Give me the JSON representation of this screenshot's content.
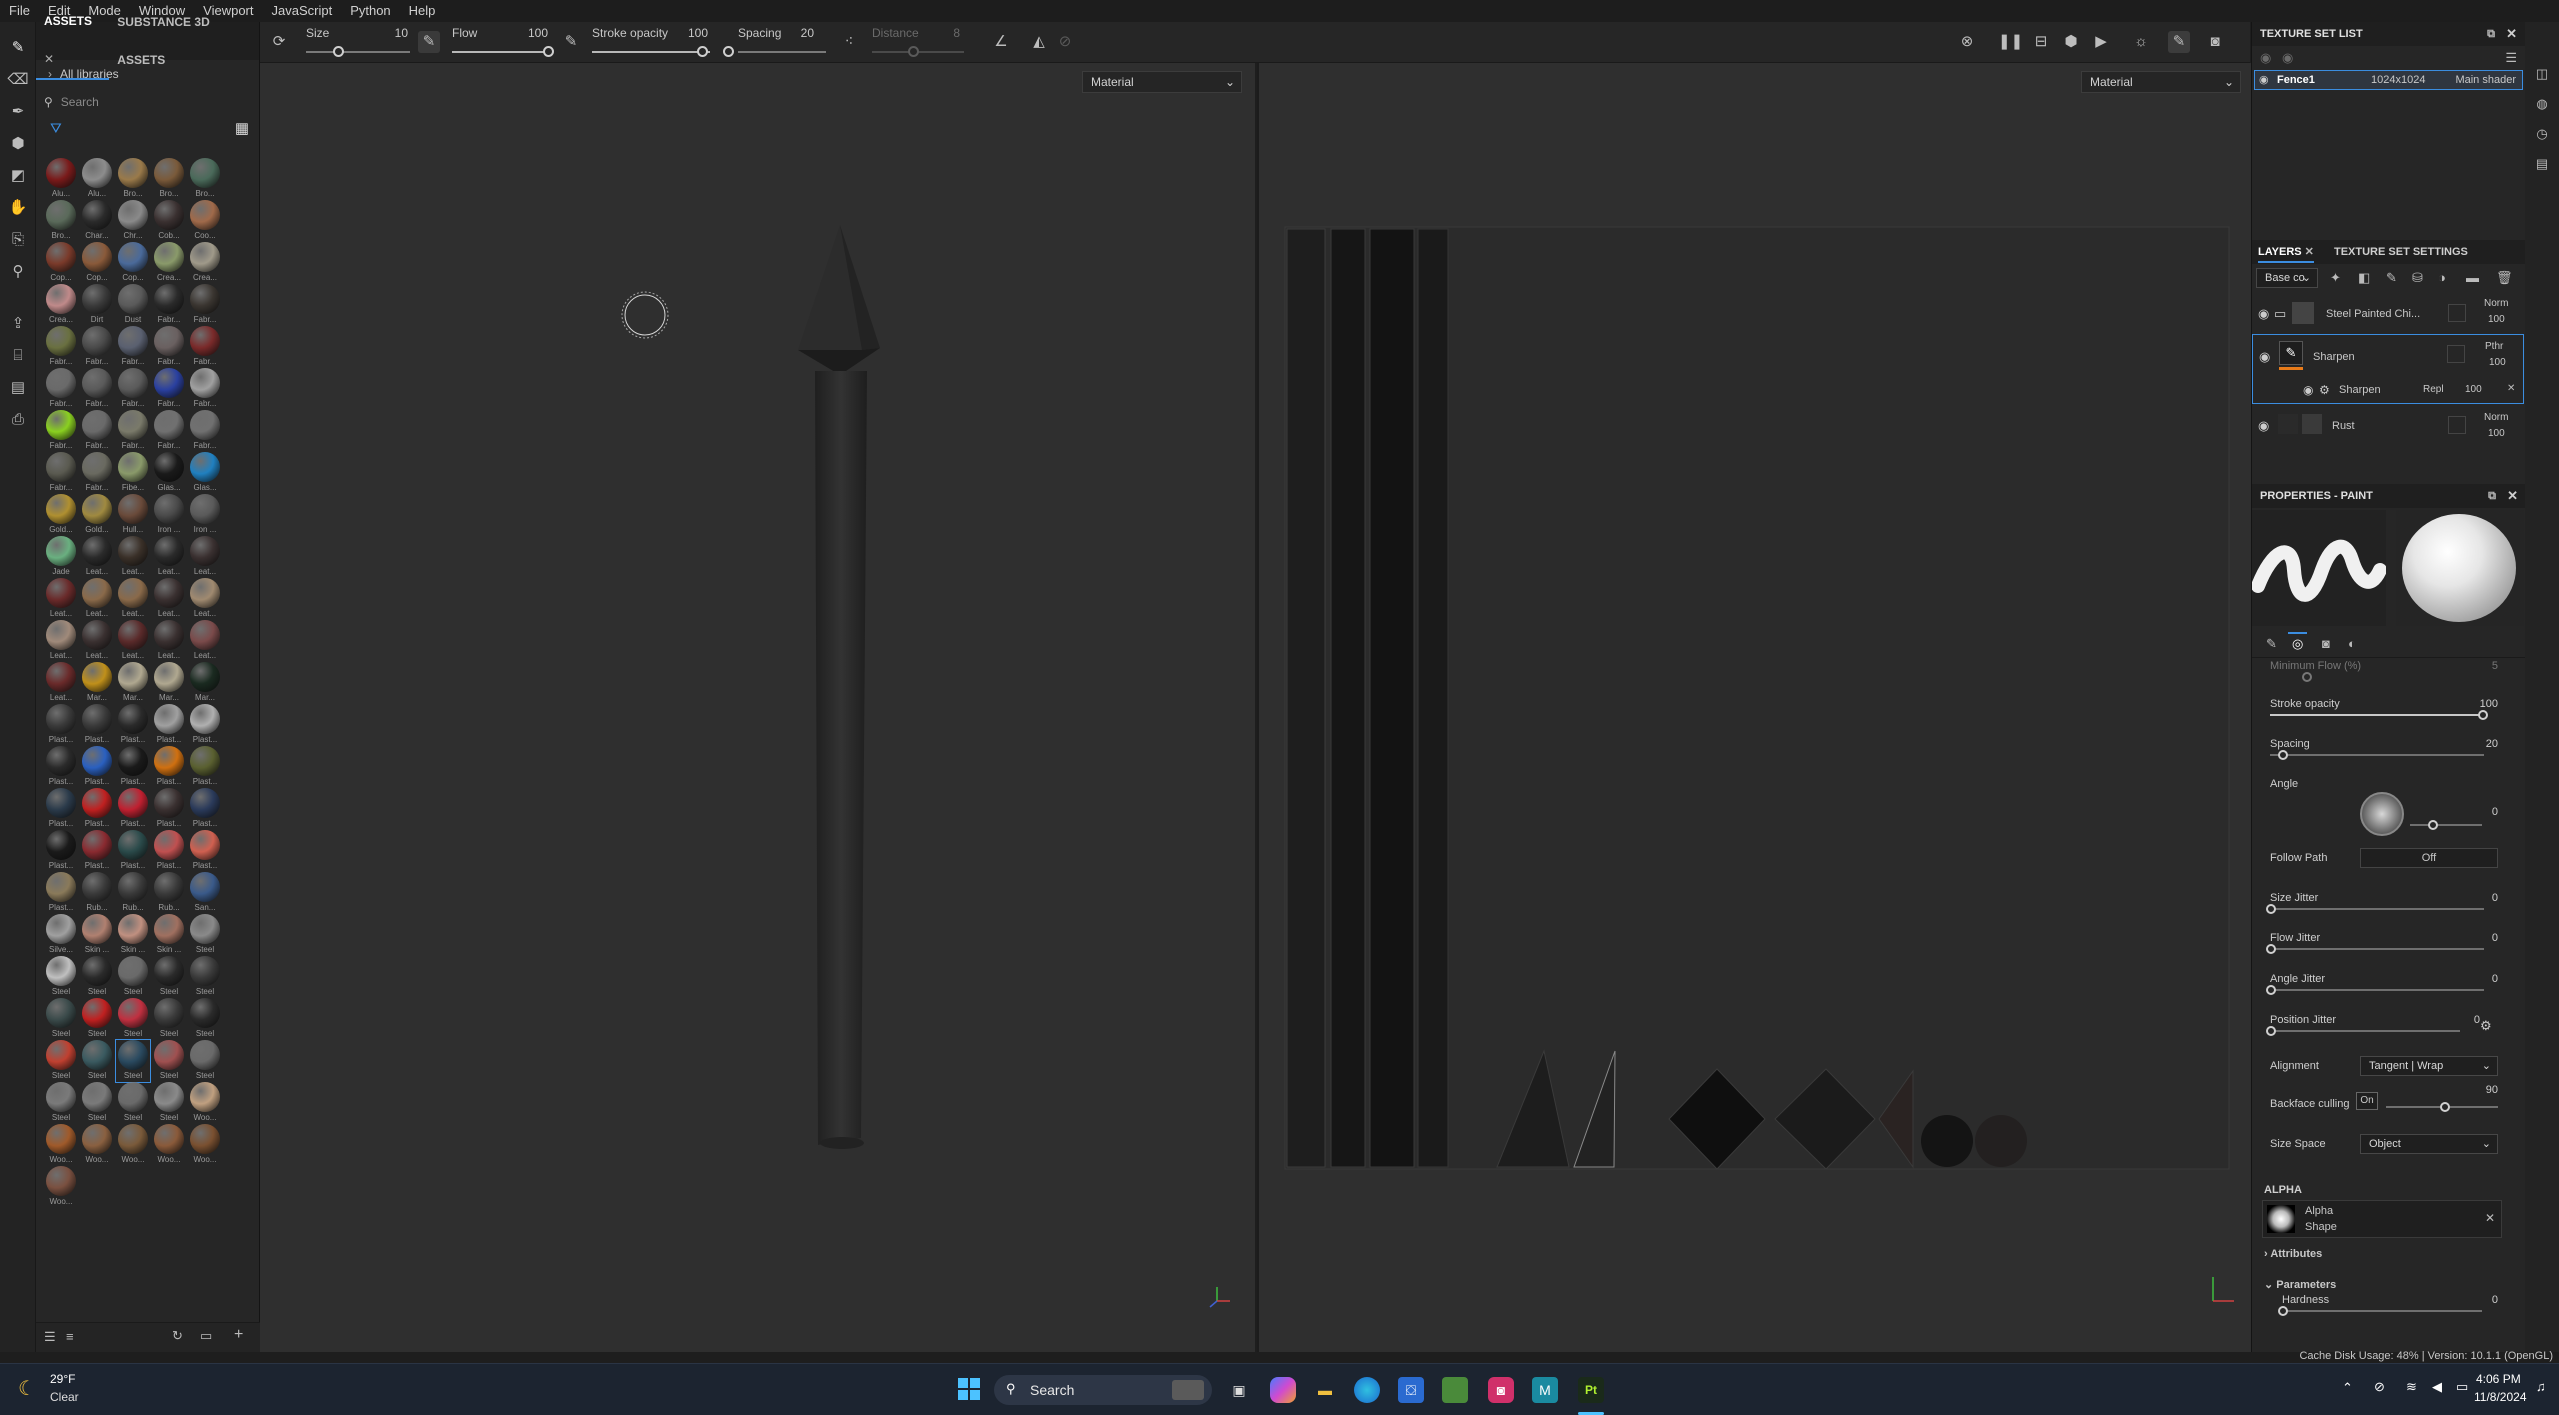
{
  "menu": [
    "File",
    "Edit",
    "Mode",
    "Window",
    "Viewport",
    "JavaScript",
    "Python",
    "Help"
  ],
  "toolbar": {
    "size_label": "Size",
    "size_value": "10",
    "flow_label": "Flow",
    "flow_value": "100",
    "stroke_opacity_label": "Stroke opacity",
    "stroke_opacity_value": "100",
    "spacing_label": "Spacing",
    "spacing_value": "20",
    "distance_label": "Distance",
    "distance_value": "8"
  },
  "assets": {
    "tab_assets": "ASSETS",
    "tab_substance": "SUBSTANCE 3D ASSETS",
    "all_libraries": "All libraries",
    "search_placeholder": "Search",
    "materials": [
      {
        "name": "Alu...",
        "color": "#7a1a1a"
      },
      {
        "name": "Alu...",
        "color": "#8d8d8d"
      },
      {
        "name": "Bro...",
        "color": "#9a7a4a"
      },
      {
        "name": "Bro...",
        "color": "#7a5a3a"
      },
      {
        "name": "Bro...",
        "color": "#4a6a5a"
      },
      {
        "name": "Bro...",
        "color": "#5a6a5a"
      },
      {
        "name": "Char...",
        "color": "#2a2a2a"
      },
      {
        "name": "Chr...",
        "color": "#8a8a8a"
      },
      {
        "name": "Cob...",
        "color": "#3a3030"
      },
      {
        "name": "Coo...",
        "color": "#a06a4a"
      },
      {
        "name": "Cop...",
        "color": "#7a3a2a"
      },
      {
        "name": "Cop...",
        "color": "#8a5a3a"
      },
      {
        "name": "Cop...",
        "color": "#4a6a9a"
      },
      {
        "name": "Crea...",
        "color": "#8a9a6a"
      },
      {
        "name": "Crea...",
        "color": "#a09a8a"
      },
      {
        "name": "Crea...",
        "color": "#c08a8a"
      },
      {
        "name": "Dirt",
        "color": "#3a3a3a"
      },
      {
        "name": "Dust",
        "color": "#5a5a5a"
      },
      {
        "name": "Fabr...",
        "color": "#2a2a2a"
      },
      {
        "name": "Fabr...",
        "color": "#3a3530"
      },
      {
        "name": "Fabr...",
        "color": "#6a7040"
      },
      {
        "name": "Fabr...",
        "color": "#4a4a4a"
      },
      {
        "name": "Fabr...",
        "color": "#5a6070"
      },
      {
        "name": "Fabr...",
        "color": "#6a6060"
      },
      {
        "name": "Fabr...",
        "color": "#7a2a2a"
      },
      {
        "name": "Fabr...",
        "color": "#6a6a6a"
      },
      {
        "name": "Fabr...",
        "color": "#5a5a5a"
      },
      {
        "name": "Fabr...",
        "color": "#5a5a5a"
      },
      {
        "name": "Fabr...",
        "color": "#2a40a0"
      },
      {
        "name": "Fabr...",
        "color": "#a0a0a0"
      },
      {
        "name": "Fabr...",
        "color": "#8ad020"
      },
      {
        "name": "Fabr...",
        "color": "#6a6a6a"
      },
      {
        "name": "Fabr...",
        "color": "#7a7a6a"
      },
      {
        "name": "Fabr...",
        "color": "#707070"
      },
      {
        "name": "Fabr...",
        "color": "#707070"
      },
      {
        "name": "Fabr...",
        "color": "#5a5a50"
      },
      {
        "name": "Fabr...",
        "color": "#6a6a60"
      },
      {
        "name": "Fibe...",
        "color": "#8a9a6a"
      },
      {
        "name": "Glas...",
        "color": "#1a1a1a"
      },
      {
        "name": "Glas...",
        "color": "#2080c0"
      },
      {
        "name": "Gold...",
        "color": "#b09030"
      },
      {
        "name": "Gold...",
        "color": "#a08a40"
      },
      {
        "name": "Hull...",
        "color": "#6a4a3a"
      },
      {
        "name": "Iron ...",
        "color": "#4a4a4a"
      },
      {
        "name": "Iron ...",
        "color": "#5a5a5a"
      },
      {
        "name": "Jade",
        "color": "#6ab080"
      },
      {
        "name": "Leat...",
        "color": "#2a2a2a"
      },
      {
        "name": "Leat...",
        "color": "#3a3028"
      },
      {
        "name": "Leat...",
        "color": "#2a2a2a"
      },
      {
        "name": "Leat...",
        "color": "#3a3030"
      },
      {
        "name": "Leat...",
        "color": "#6a2a2a"
      },
      {
        "name": "Leat...",
        "color": "#8a6a4a"
      },
      {
        "name": "Leat...",
        "color": "#8a6a4a"
      },
      {
        "name": "Leat...",
        "color": "#3a3030"
      },
      {
        "name": "Leat...",
        "color": "#a08a70"
      },
      {
        "name": "Leat...",
        "color": "#a08a7a"
      },
      {
        "name": "Leat...",
        "color": "#3a3030"
      },
      {
        "name": "Leat...",
        "color": "#5a2a2a"
      },
      {
        "name": "Leat...",
        "color": "#3a3030"
      },
      {
        "name": "Leat...",
        "color": "#7a4a4a"
      },
      {
        "name": "Leat...",
        "color": "#6a2a2a"
      },
      {
        "name": "Mar...",
        "color": "#c0901a"
      },
      {
        "name": "Mar...",
        "color": "#b0a890"
      },
      {
        "name": "Mar...",
        "color": "#b0a890"
      },
      {
        "name": "Mar...",
        "color": "#1a2a20"
      },
      {
        "name": "Plast...",
        "color": "#3a3a3a"
      },
      {
        "name": "Plast...",
        "color": "#3a3a3a"
      },
      {
        "name": "Plast...",
        "color": "#2a2a2a"
      },
      {
        "name": "Plast...",
        "color": "#a0a0a0"
      },
      {
        "name": "Plast...",
        "color": "#b0b0b0"
      },
      {
        "name": "Plast...",
        "color": "#2a2a2a"
      },
      {
        "name": "Plast...",
        "color": "#2a60c0"
      },
      {
        "name": "Plast...",
        "color": "#1a1a1a"
      },
      {
        "name": "Plast...",
        "color": "#d07010"
      },
      {
        "name": "Plast...",
        "color": "#5a6030"
      },
      {
        "name": "Plast...",
        "color": "#2a3a4a"
      },
      {
        "name": "Plast...",
        "color": "#c02020"
      },
      {
        "name": "Plast...",
        "color": "#c02030"
      },
      {
        "name": "Plast...",
        "color": "#3a3030"
      },
      {
        "name": "Plast...",
        "color": "#2a3a5a"
      },
      {
        "name": "Plast...",
        "color": "#1a1a1a"
      },
      {
        "name": "Plast...",
        "color": "#8a2a30"
      },
      {
        "name": "Plast...",
        "color": "#2a4a4a"
      },
      {
        "name": "Plast...",
        "color": "#c05050"
      },
      {
        "name": "Plast...",
        "color": "#d06050"
      },
      {
        "name": "Plast...",
        "color": "#8a7a5a"
      },
      {
        "name": "Rub...",
        "color": "#3a3a3a"
      },
      {
        "name": "Rub...",
        "color": "#3a3a3a"
      },
      {
        "name": "Rub...",
        "color": "#3a3a3a"
      },
      {
        "name": "San...",
        "color": "#3a5a8a"
      },
      {
        "name": "Silve...",
        "color": "#a0a0a0"
      },
      {
        "name": "Skin ...",
        "color": "#b08070"
      },
      {
        "name": "Skin ...",
        "color": "#c09080"
      },
      {
        "name": "Skin ...",
        "color": "#a07060"
      },
      {
        "name": "Steel",
        "color": "#8a8a8a"
      },
      {
        "name": "Steel",
        "color": "#c0c0c0"
      },
      {
        "name": "Steel",
        "color": "#2a2a2a"
      },
      {
        "name": "Steel",
        "color": "#6a6a6a"
      },
      {
        "name": "Steel",
        "color": "#2a2a2a"
      },
      {
        "name": "Steel",
        "color": "#3a3a3a"
      },
      {
        "name": "Steel",
        "color": "#3a4a4a"
      },
      {
        "name": "Steel",
        "color": "#c02020"
      },
      {
        "name": "Steel",
        "color": "#c03040"
      },
      {
        "name": "Steel",
        "color": "#3a3a3a"
      },
      {
        "name": "Steel",
        "color": "#2a2a2a"
      },
      {
        "name": "Steel",
        "color": "#c04030"
      },
      {
        "name": "Steel",
        "color": "#3a5a60"
      },
      {
        "name": "Steel",
        "color": "#2a4a60"
      },
      {
        "name": "Steel",
        "color": "#a05050"
      },
      {
        "name": "Steel",
        "color": "#6a6a6a"
      },
      {
        "name": "Steel",
        "color": "#7a7a7a"
      },
      {
        "name": "Steel",
        "color": "#7a7a7a"
      },
      {
        "name": "Steel",
        "color": "#6a6a6a"
      },
      {
        "name": "Steel",
        "color": "#8a8a8a"
      },
      {
        "name": "Woo...",
        "color": "#c0a080"
      },
      {
        "name": "Woo...",
        "color": "#a05a2a"
      },
      {
        "name": "Woo...",
        "color": "#8a6040"
      },
      {
        "name": "Woo...",
        "color": "#7a5a3a"
      },
      {
        "name": "Woo...",
        "color": "#8a5a3a"
      },
      {
        "name": "Woo...",
        "color": "#7a5030"
      },
      {
        "name": "Woo...",
        "color": "#7a5040"
      }
    ]
  },
  "viewport3d": {
    "material_select": "Material"
  },
  "viewport2d": {
    "material_select": "Material"
  },
  "texture_set_list": {
    "title": "TEXTURE SET LIST",
    "name": "Fence1",
    "resolution": "1024x1024",
    "shader": "Main shader"
  },
  "layers": {
    "tab_layers": "LAYERS",
    "tab_settings": "TEXTURE SET SETTINGS",
    "channel_select": "Base co",
    "items": [
      {
        "name": "Steel Painted Chi...",
        "blend": "Norm",
        "opacity": "100"
      },
      {
        "name": "Sharpen",
        "blend": "Pthr",
        "opacity": "100"
      },
      {
        "name": "Sharpen",
        "blend": "Repl",
        "opacity": "100"
      },
      {
        "name": "Rust",
        "blend": "Norm",
        "opacity": "100"
      }
    ]
  },
  "properties": {
    "title": "PROPERTIES - PAINT",
    "min_flow_label": "Minimum Flow (%)",
    "min_flow_value": "5",
    "stroke_opacity_label": "Stroke opacity",
    "stroke_opacity_value": "100",
    "spacing_label": "Spacing",
    "spacing_value": "20",
    "angle_label": "Angle",
    "angle_value": "0",
    "follow_path_label": "Follow Path",
    "follow_path_value": "Off",
    "size_jitter_label": "Size Jitter",
    "size_jitter_value": "0",
    "flow_jitter_label": "Flow Jitter",
    "flow_jitter_value": "0",
    "angle_jitter_label": "Angle Jitter",
    "angle_jitter_value": "0",
    "position_jitter_label": "Position Jitter",
    "position_jitter_value": "0",
    "alignment_label": "Alignment",
    "alignment_value": "Tangent | Wrap",
    "backface_label": "Backface culling",
    "backface_value": "On",
    "backface_angle": "90",
    "size_space_label": "Size Space",
    "size_space_value": "Object",
    "alpha_section": "ALPHA",
    "alpha_name": "Alpha",
    "alpha_type": "Shape",
    "attributes_label": "Attributes",
    "parameters_label": "Parameters",
    "hardness_label": "Hardness",
    "hardness_value": "0"
  },
  "status": {
    "text": "Cache Disk Usage:  48% | Version: 10.1.1 (OpenGL)"
  },
  "taskbar": {
    "weather_temp": "29°F",
    "weather_cond": "Clear",
    "search_label": "Search",
    "time": "4:06 PM",
    "date": "11/8/2024"
  }
}
